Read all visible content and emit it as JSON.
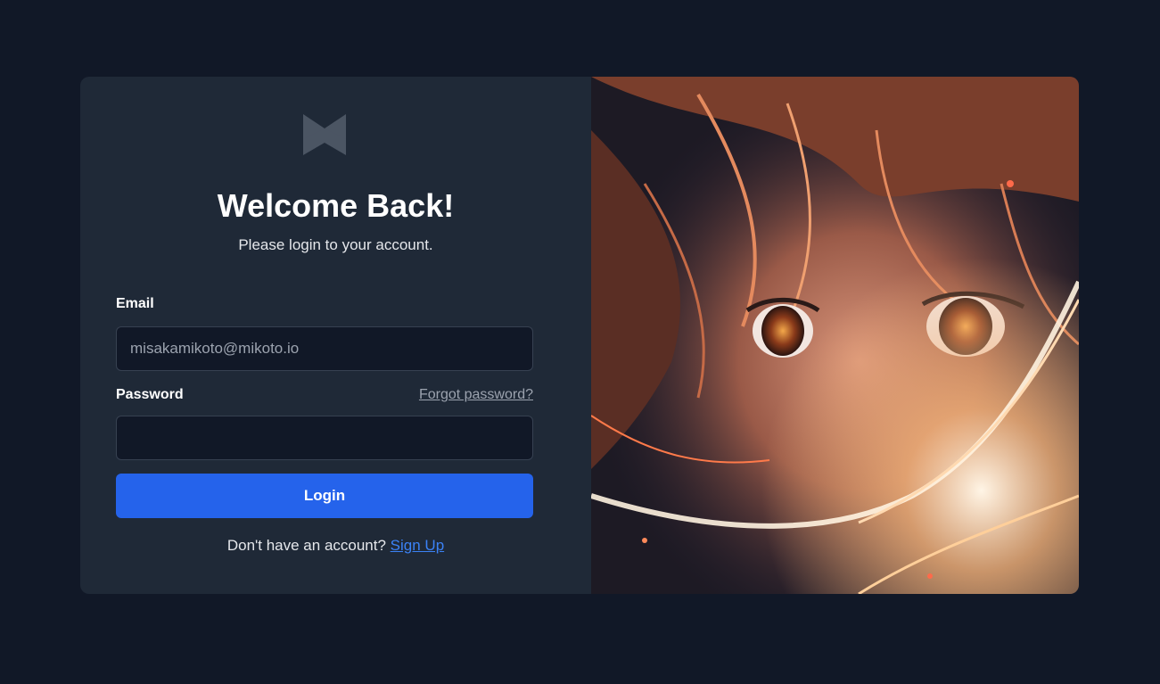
{
  "login": {
    "title": "Welcome Back!",
    "subtitle": "Please login to your account.",
    "email_label": "Email",
    "email_value": "misakamikoto@mikoto.io",
    "password_label": "Password",
    "forgot_password": "Forgot password?",
    "login_button": "Login",
    "signup_prompt": "Don't have an account?",
    "signup_link": "Sign Up"
  },
  "logo_icon": "brand-logo-icon",
  "colors": {
    "background": "#111827",
    "panel": "#1f2937",
    "input_bg": "#111827",
    "accent": "#2563eb",
    "link": "#3b82f6"
  }
}
